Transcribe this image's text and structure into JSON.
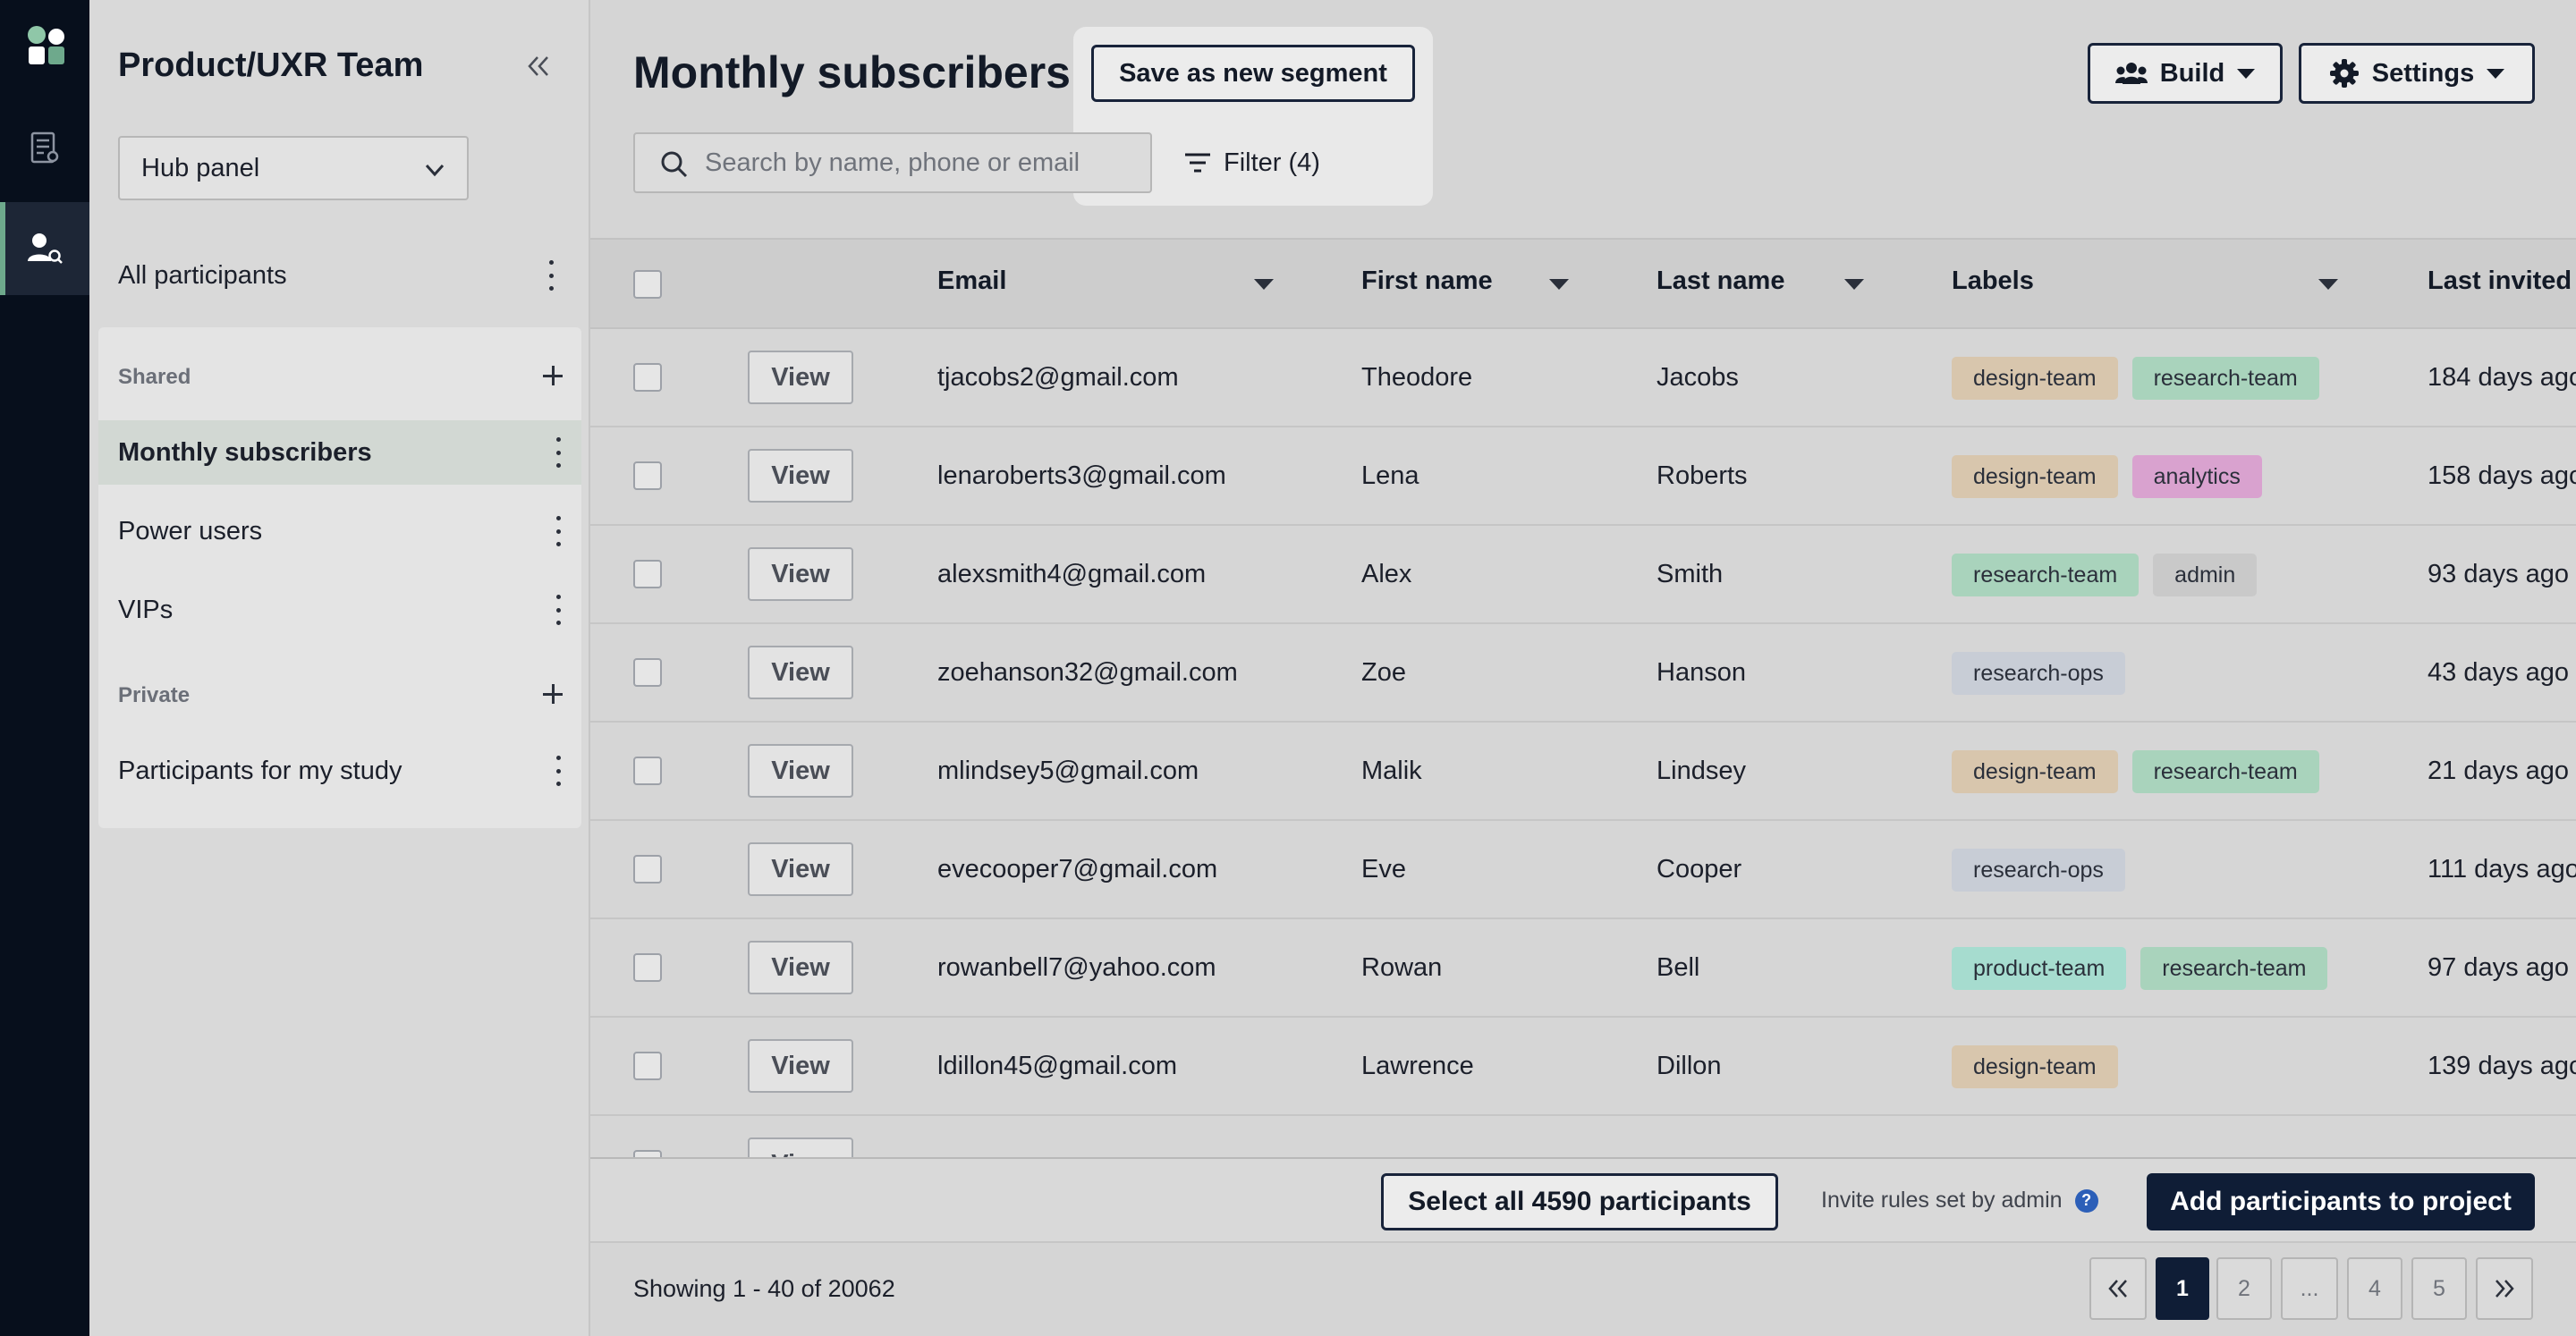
{
  "sidebar": {
    "team_title": "Product/UXR Team",
    "panel_select": "Hub panel",
    "all_participants": "All participants",
    "shared_heading": "Shared",
    "shared_items": [
      "Monthly subscribers",
      "Power users",
      "VIPs"
    ],
    "private_heading": "Private",
    "private_items": [
      "Participants for my study"
    ]
  },
  "header": {
    "title": "Monthly subscribers",
    "save_segment": "Save as new segment",
    "build": "Build",
    "settings": "Settings",
    "search_placeholder": "Search by name, phone or email",
    "filter": "Filter (4)"
  },
  "table": {
    "columns": [
      "Email",
      "First name",
      "Last name",
      "Labels",
      "Last invited"
    ],
    "view_label": "View",
    "rows": [
      {
        "email": "tjacobs2@gmail.com",
        "first": "Theodore",
        "last": "Jacobs",
        "labels": [
          "design-team",
          "research-team"
        ],
        "invited": "184 days ago"
      },
      {
        "email": "lenaroberts3@gmail.com",
        "first": "Lena",
        "last": "Roberts",
        "labels": [
          "design-team",
          "analytics"
        ],
        "invited": "158 days ago"
      },
      {
        "email": "alexsmith4@gmail.com",
        "first": "Alex",
        "last": "Smith",
        "labels": [
          "research-team",
          "admin"
        ],
        "invited": "93 days ago"
      },
      {
        "email": "zoehanson32@gmail.com",
        "first": "Zoe",
        "last": "Hanson",
        "labels": [
          "research-ops"
        ],
        "invited": "43 days ago"
      },
      {
        "email": "mlindsey5@gmail.com",
        "first": "Malik",
        "last": "Lindsey",
        "labels": [
          "design-team",
          "research-team"
        ],
        "invited": "21 days ago"
      },
      {
        "email": "evecooper7@gmail.com",
        "first": "Eve",
        "last": "Cooper",
        "labels": [
          "research-ops"
        ],
        "invited": "111 days ago"
      },
      {
        "email": "rowanbell7@yahoo.com",
        "first": "Rowan",
        "last": "Bell",
        "labels": [
          "product-team",
          "research-team"
        ],
        "invited": "97 days ago"
      },
      {
        "email": "ldillon45@gmail.com",
        "first": "Lawrence",
        "last": "Dillon",
        "labels": [
          "design-team"
        ],
        "invited": "139 days ago"
      }
    ]
  },
  "label_colors": {
    "design-team": "#d8c6ad",
    "research-team": "#a9d3bc",
    "analytics": "#d9a2cf",
    "admin": "#c9c9c9",
    "research-ops": "#c8cdd6",
    "product-team": "#a6dccf"
  },
  "footer": {
    "select_all": "Select all 4590 participants",
    "invite_rules": "Invite rules set by admin",
    "help_icon": "?",
    "add_to_project": "Add participants to project",
    "showing": "Showing 1 - 40 of 20062",
    "pages": [
      "1",
      "2",
      "...",
      "4",
      "5"
    ]
  },
  "colors": {
    "rail_bg": "#070f1c",
    "accent_green": "#6ea98c",
    "primary_dark": "#0f1d36"
  },
  "icons": {
    "logo": "app-logo-icon",
    "nav_documents": "documents-icon",
    "nav_participants": "participants-search-icon",
    "collapse": "double-chevron-left-icon",
    "search": "search-icon",
    "filter": "filter-icon",
    "build": "people-icon",
    "settings": "gear-icon"
  }
}
